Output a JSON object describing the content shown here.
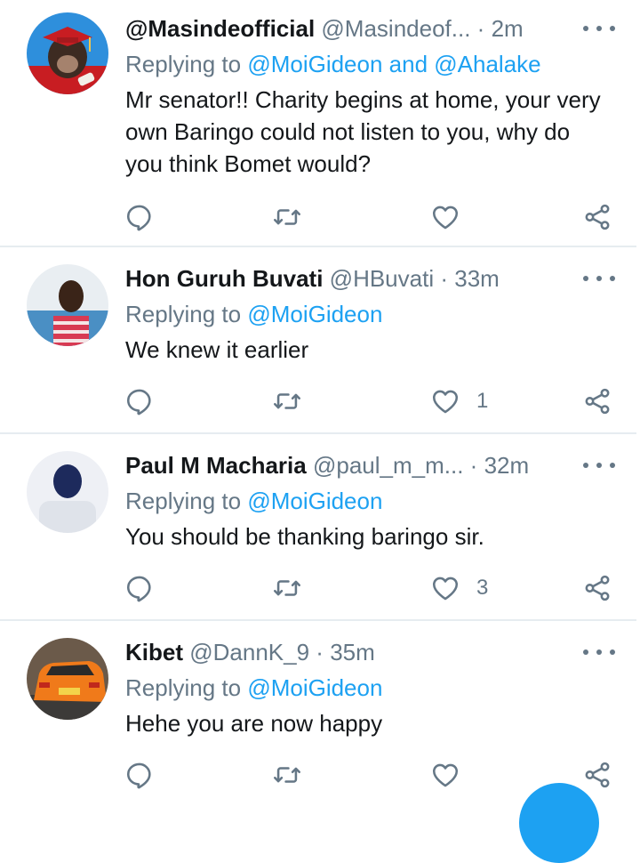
{
  "colors": {
    "accent": "#1da1f2",
    "muted": "#657786",
    "divider": "#e6ecf0"
  },
  "tweets": [
    {
      "name": "@Masindeofficial",
      "handle": "@Masindeof...",
      "time": "2m",
      "replying_prefix": "Replying to ",
      "mentions": "@MoiGideon and @Ahalake",
      "text": "Mr senator!! Charity begins at home, your very own Baringo could not listen to you, why do you think Bomet would?",
      "avatar_icon": "chimp-graduate-avatar",
      "reply_count": "",
      "retweet_count": "",
      "like_count": ""
    },
    {
      "name": "Hon Guruh Buvati",
      "handle": "@HBuvati",
      "time": "33m",
      "replying_prefix": "Replying to ",
      "mentions": "@MoiGideon",
      "text": "We knew it earlier",
      "avatar_icon": "person-striped-shirt-avatar",
      "reply_count": "",
      "retweet_count": "",
      "like_count": "1"
    },
    {
      "name": "Paul M Macharia",
      "handle": "@paul_m_m...",
      "time": "32m",
      "replying_prefix": "Replying to ",
      "mentions": "@MoiGideon",
      "text": "You should be thanking baringo sir.",
      "avatar_icon": "person-hoodie-avatar",
      "reply_count": "",
      "retweet_count": "",
      "like_count": "3"
    },
    {
      "name": "Kibet",
      "handle": "@DannK_9",
      "time": "35m",
      "replying_prefix": "Replying to ",
      "mentions": "@MoiGideon",
      "text": "Hehe you are now happy",
      "avatar_icon": "orange-car-avatar",
      "reply_count": "",
      "retweet_count": "",
      "like_count": ""
    }
  ],
  "dot_separator": "·"
}
